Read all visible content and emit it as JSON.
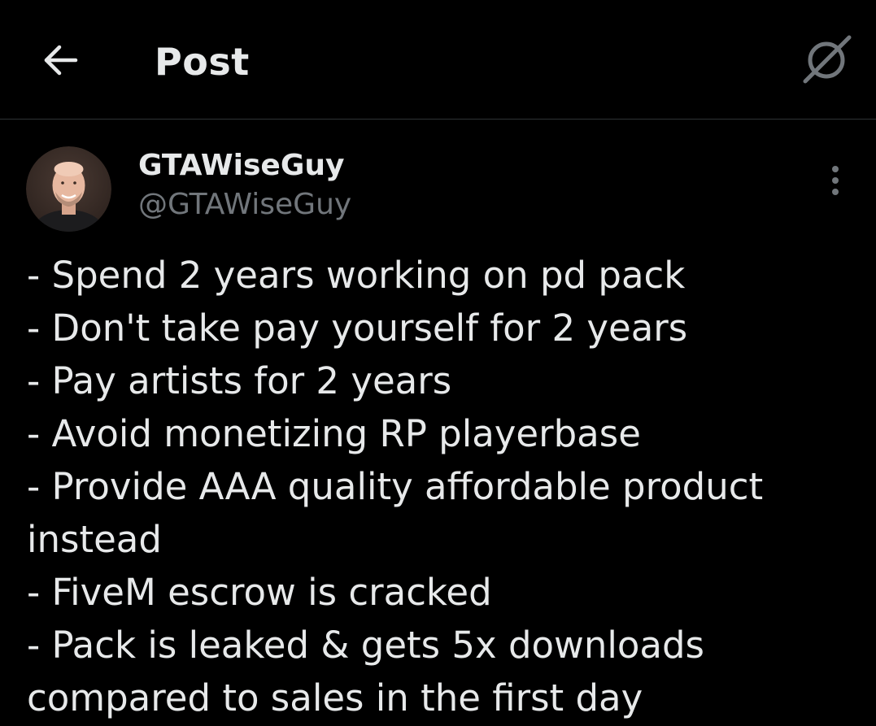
{
  "header": {
    "title": "Post",
    "back_icon": "arrow-left-icon",
    "grok_icon": "grok-slash-icon"
  },
  "author": {
    "display_name": "GTAWiseGuy",
    "handle": "@GTAWiseGuy",
    "more_icon": "vertical-ellipsis-icon"
  },
  "post": {
    "lines": [
      "- Spend 2 years working on pd pack",
      "- Don't take pay yourself for 2 years",
      "- Pay artists for 2 years",
      "- Avoid monetizing RP playerbase",
      "- Provide AAA quality affordable product",
      "instead",
      "- FiveM escrow is cracked",
      "- Pack is leaked & gets 5x downloads",
      "compared to sales in the first day"
    ]
  },
  "colors": {
    "background": "#000000",
    "primary_text": "#e7e9ea",
    "secondary_text": "#71767b",
    "divider": "#2f3336"
  }
}
